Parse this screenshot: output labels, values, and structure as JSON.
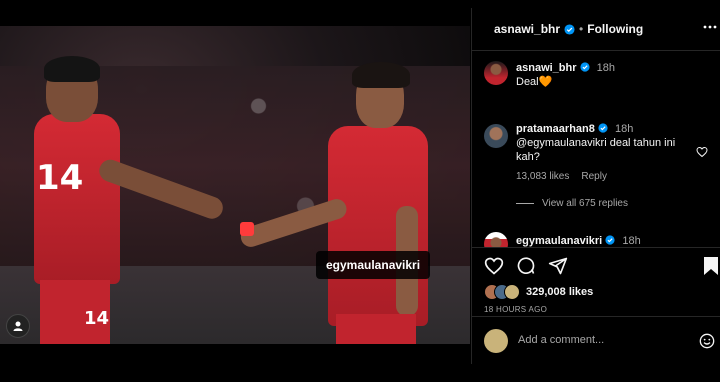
{
  "post": {
    "author": "asnawi_bhr",
    "separator": "•",
    "follow_label": "Following",
    "photo_tag": "egymaulanavikri",
    "player_left_number": "14",
    "player_left_shorts_number": "14"
  },
  "comments": [
    {
      "user": "asnawi_bhr",
      "time": "18h",
      "text": "Deal🧡"
    },
    {
      "user": "pratamaarhan8",
      "time": "18h",
      "text": "@egymaulanavikri deal tahun ini kah?",
      "likes": "13,083 likes",
      "reply_label": "Reply",
      "view_replies": "View all 675 replies"
    },
    {
      "user": "egymaulanavikri",
      "time": "18h"
    }
  ],
  "engagement": {
    "likes": "329,008 likes",
    "timestamp": "18 HOURS AGO"
  },
  "composer": {
    "placeholder": "Add a comment..."
  },
  "colors": {
    "verified": "#0095f6",
    "jersey": "#c1242e",
    "background": "#000000"
  },
  "icons": [
    "verified-icon",
    "more-icon",
    "heart-icon",
    "comment-icon",
    "share-icon",
    "save-icon",
    "emoji-icon",
    "user-tag-icon"
  ]
}
